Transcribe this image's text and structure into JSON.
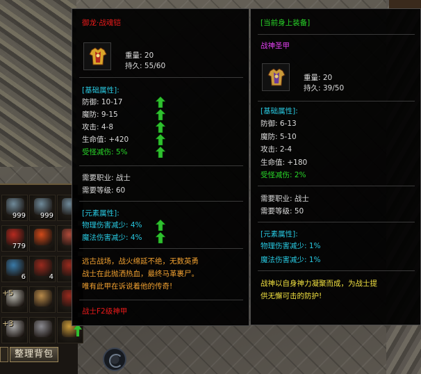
{
  "bag": {
    "slots": [
      {
        "icon": "stone-statue-icon",
        "count": "999",
        "plus": ""
      },
      {
        "icon": "stone-statue-icon",
        "count": "999",
        "plus": ""
      },
      {
        "icon": "stone-statue-icon",
        "count": "",
        "plus": ""
      },
      {
        "icon": "red-potion-icon",
        "count": "779",
        "plus": ""
      },
      {
        "icon": "fire-orb-icon",
        "count": "",
        "plus": ""
      },
      {
        "icon": "scroll-icon",
        "count": "",
        "plus": ""
      },
      {
        "icon": "blue-scroll-icon",
        "count": "6",
        "plus": ""
      },
      {
        "icon": "red-scroll-icon",
        "count": "4",
        "plus": ""
      },
      {
        "icon": "red-scroll-icon",
        "count": "",
        "plus": ""
      },
      {
        "icon": "necklace-icon",
        "count": "",
        "plus": "+5"
      },
      {
        "icon": "root-icon",
        "count": "",
        "plus": ""
      },
      {
        "icon": "red-scroll-icon",
        "count": "",
        "plus": ""
      },
      {
        "icon": "ring-icon",
        "count": "",
        "plus": "+3"
      },
      {
        "icon": "bracelet-icon",
        "count": "",
        "plus": ""
      },
      {
        "icon": "armor-icon",
        "count": "",
        "plus": ""
      }
    ],
    "sort_button": "整理背包"
  },
  "tooltip_left": {
    "name": "御龙·战魂铠",
    "weight": "重量: 20",
    "durability": "持久: 55/60",
    "base_header": "[基础属性]:",
    "stats": [
      {
        "label": "防御: 10-17",
        "arrow": true,
        "color": "white"
      },
      {
        "label": "魔防: 9-15",
        "arrow": true,
        "color": "white"
      },
      {
        "label": "攻击: 4-8",
        "arrow": true,
        "color": "white"
      },
      {
        "label": "生命值: +420",
        "arrow": true,
        "color": "white"
      },
      {
        "label": "受怪减伤: 5%",
        "arrow": true,
        "color": "green"
      }
    ],
    "job": "需要职业: 战士",
    "level": "需要等级: 60",
    "element_header": "[元素属性]:",
    "elements": [
      {
        "label": "物理伤害减少: 4%",
        "arrow": true
      },
      {
        "label": "魔法伤害减少: 4%",
        "arrow": true
      }
    ],
    "desc": [
      "远古战场，战火绵延不绝，无数英勇",
      "战士在此抛洒热血，最终马革裹尸。",
      "唯有此甲在诉说着他的传奇!"
    ],
    "footer": "战士F2级神甲"
  },
  "tooltip_right": {
    "header": "[当前身上装备]",
    "name": "战神圣甲",
    "weight": "重量: 20",
    "durability": "持久: 39/50",
    "base_header": "[基础属性]:",
    "stats": [
      {
        "label": "防御: 6-13",
        "color": "white"
      },
      {
        "label": "魔防: 5-10",
        "color": "white"
      },
      {
        "label": "攻击: 2-4",
        "color": "white"
      },
      {
        "label": "生命值: +180",
        "color": "white"
      },
      {
        "label": "受怪减伤: 2%",
        "color": "green"
      }
    ],
    "job": "需要职业: 战士",
    "level": "需要等级: 50",
    "element_header": "[元素属性]:",
    "elements": [
      {
        "label": "物理伤害减少: 1%"
      },
      {
        "label": "魔法伤害减少: 1%"
      }
    ],
    "desc": [
      "战神以自身神力凝聚而成，为战士提",
      "供无懈可击的防护!"
    ]
  },
  "colors": {
    "name_red": "#e81a1a",
    "cyan": "#28c8e0",
    "green": "#28d428",
    "orange": "#f0a030",
    "magenta": "#e040f0",
    "yellow": "#f0e040"
  }
}
